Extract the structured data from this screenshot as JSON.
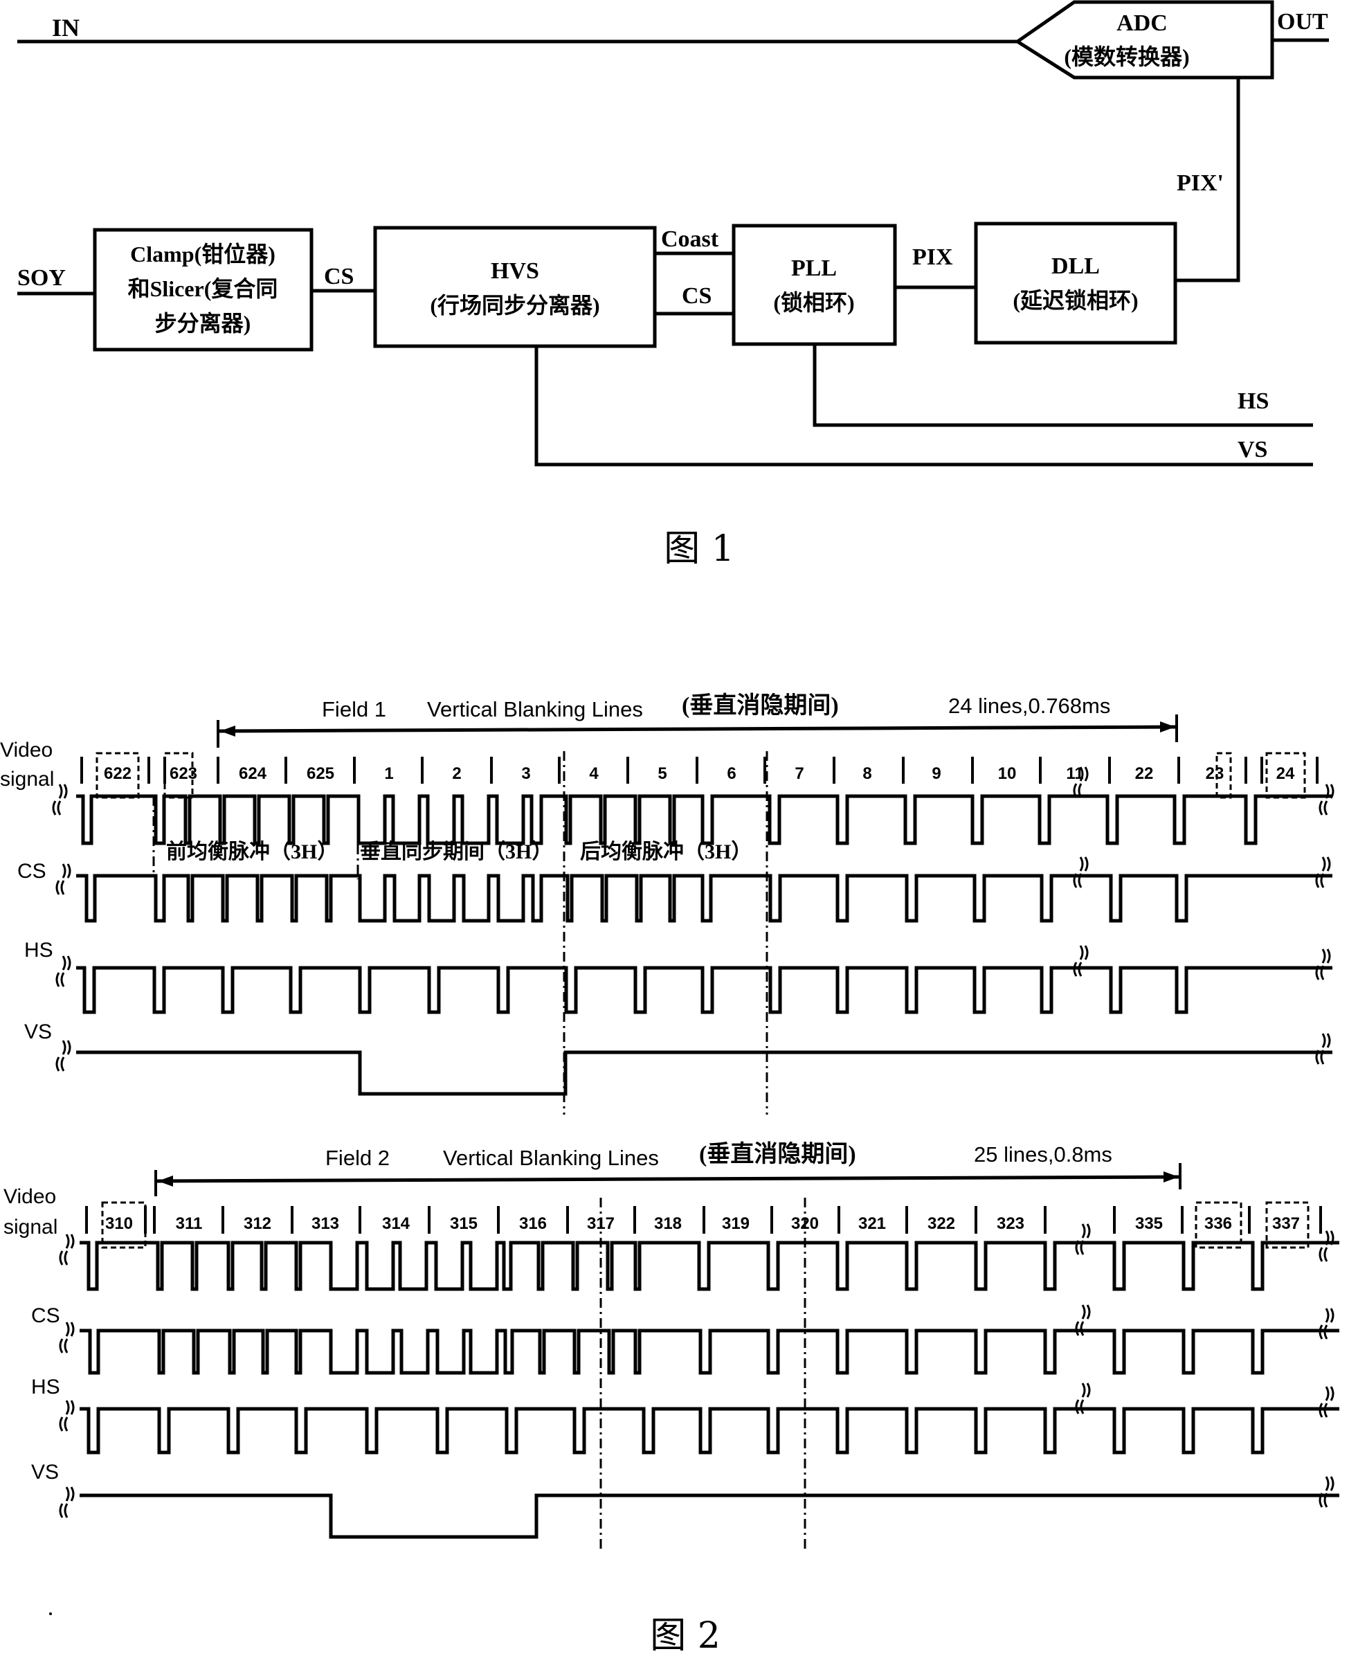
{
  "figure1": {
    "caption": "图 1",
    "signals": {
      "in": "IN",
      "out": "OUT",
      "soy": "SOY",
      "cs_clamp_hvs": "CS",
      "coast": "Coast",
      "cs_hvs_pll": "CS",
      "pix": "PIX",
      "pix_prime": "PIX'",
      "hs": "HS",
      "vs": "VS"
    },
    "blocks": {
      "adc": {
        "line1": "ADC",
        "line2": "(模数转换器)"
      },
      "clamp": {
        "line1": "Clamp(钳位器)",
        "line2": "和Slicer(复合同",
        "line3": "步分离器)"
      },
      "hvs": {
        "line1": "HVS",
        "line2": "(行场同步分离器)"
      },
      "pll": {
        "line1": "PLL",
        "line2": "(锁相环)"
      },
      "dll": {
        "line1": "DLL",
        "line2": "(延迟锁相环)"
      }
    }
  },
  "figure2": {
    "caption": "图 2",
    "row_labels": {
      "video_line1": "Video",
      "video_line2": "signal",
      "cs": "CS",
      "hs": "HS",
      "vs": "VS"
    },
    "field1": {
      "title": "Field 1",
      "blanking_label": "Vertical Blanking Lines",
      "blanking_label_cn": "(垂直消隐期间)",
      "duration": "24 lines,0.768ms",
      "line_numbers": [
        "622",
        "623",
        "624",
        "625",
        "1",
        "2",
        "3",
        "4",
        "5",
        "6",
        "7",
        "8",
        "9",
        "10",
        "11",
        "22",
        "23",
        "24"
      ],
      "phases": [
        "前均衡脉冲（3H）",
        "垂直同步期间（3H）",
        "后均衡脉冲（3H）"
      ]
    },
    "field2": {
      "title": "Field 2",
      "blanking_label": "Vertical Blanking Lines",
      "blanking_label_cn": "(垂直消隐期间)",
      "duration": "25 lines,0.8ms",
      "line_numbers": [
        "310",
        "311",
        "312",
        "313",
        "314",
        "315",
        "316",
        "317",
        "318",
        "319",
        "320",
        "321",
        "322",
        "323",
        "335",
        "336",
        "337"
      ]
    }
  }
}
